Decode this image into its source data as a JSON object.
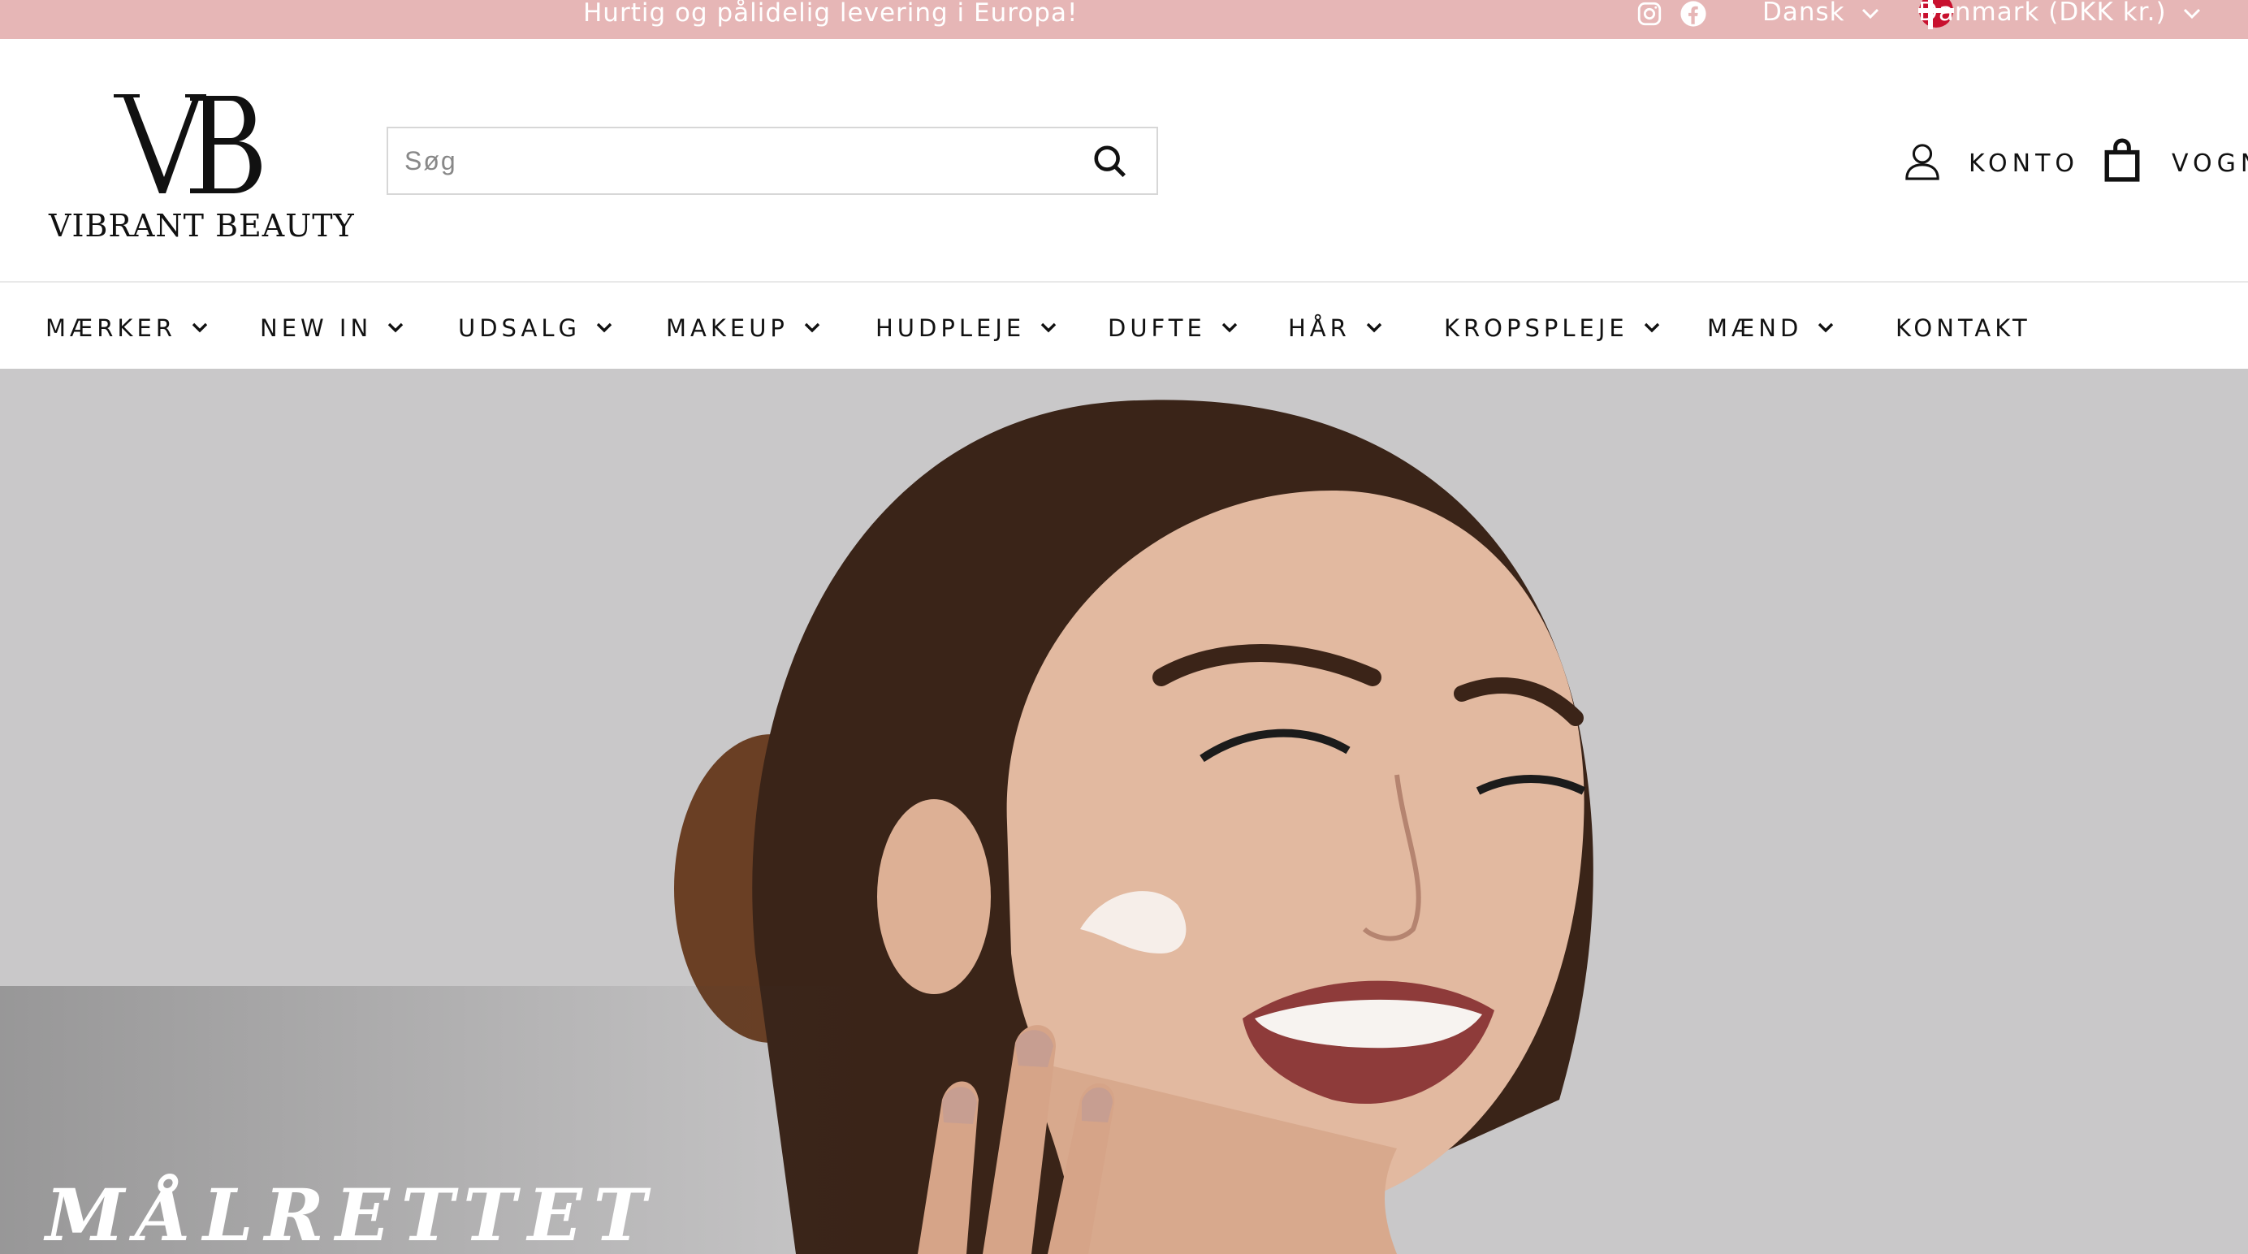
{
  "topbar": {
    "announcement": "Hurtig og pålidelig levering i Europa!",
    "language": "Dansk",
    "country": "Danmark (DKK kr.)"
  },
  "header": {
    "logo_text": "VIBRANT BEAUTY",
    "search_placeholder": "Søg",
    "account_label": "KONTO",
    "cart_label": "VOGN"
  },
  "nav": {
    "items": [
      {
        "label": "MÆRKER"
      },
      {
        "label": "NEW IN"
      },
      {
        "label": "UDSALG"
      },
      {
        "label": "MAKEUP"
      },
      {
        "label": "HUDPLEJE"
      },
      {
        "label": "DUFTE"
      },
      {
        "label": "HÅR"
      },
      {
        "label": "KROPSPLEJE"
      },
      {
        "label": "MÆND"
      },
      {
        "label": "KONTAKT"
      }
    ]
  },
  "hero": {
    "title": "MÅLRETTET"
  },
  "colors": {
    "topbar_bg": "#e6b6b6",
    "hero_bg": "#c9c8c9",
    "flag_red": "#c8102e"
  },
  "icons": [
    "instagram-icon",
    "facebook-icon",
    "chevron-down-icon",
    "denmark-flag-icon",
    "search-icon",
    "user-icon",
    "shopping-bag-icon"
  ]
}
